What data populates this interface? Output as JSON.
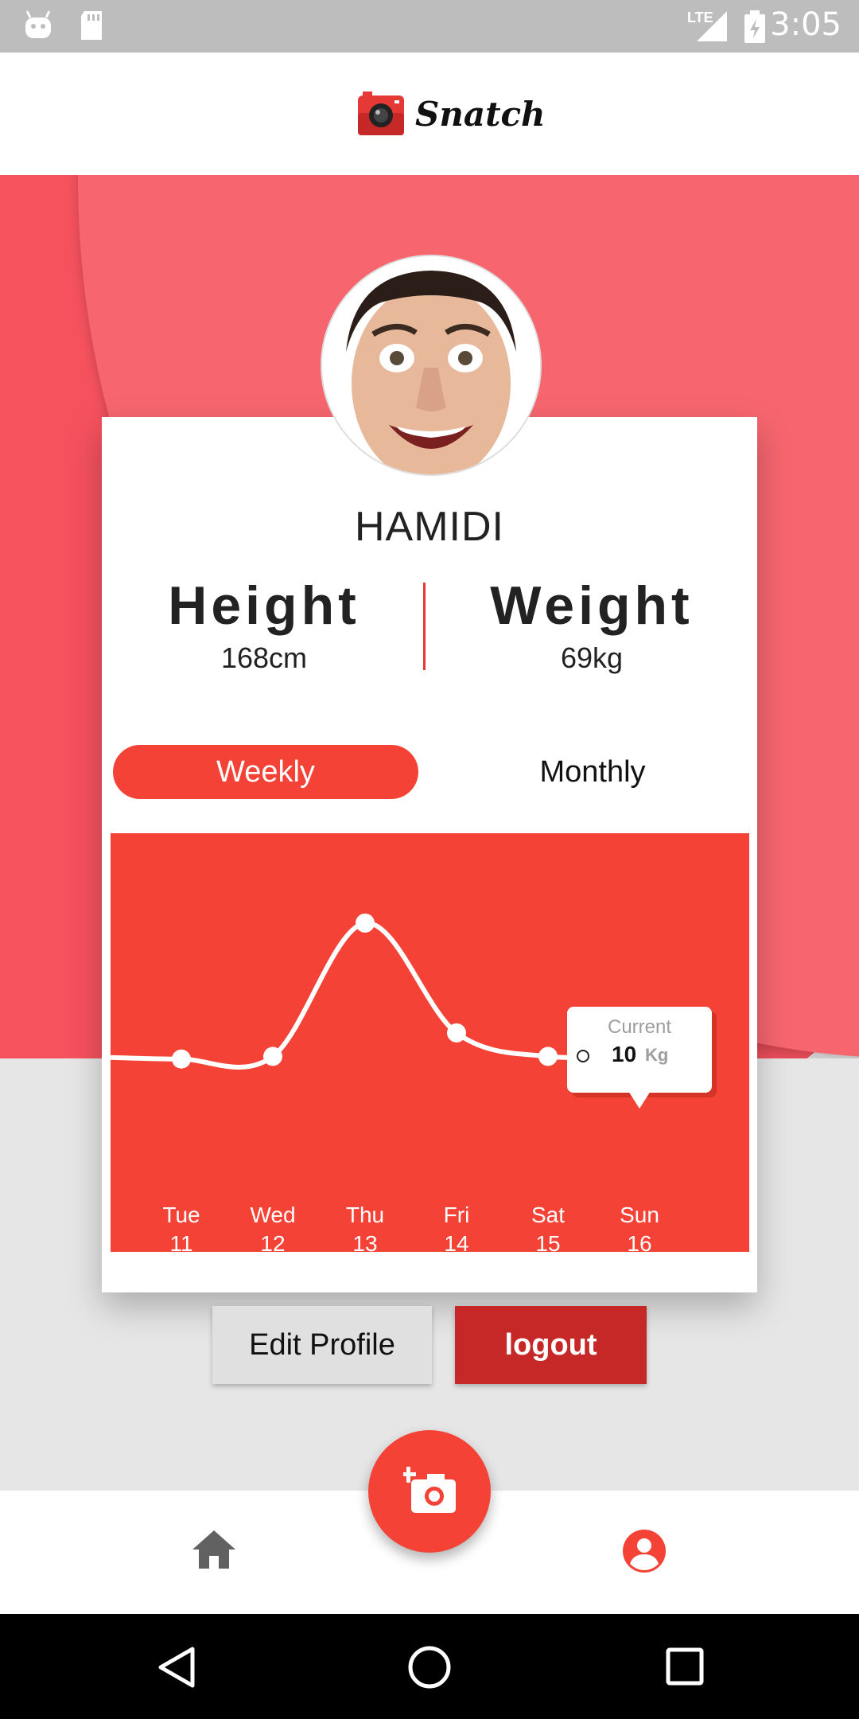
{
  "status_bar": {
    "time": "3:05",
    "network": "LTE"
  },
  "app": {
    "name": "Snatch"
  },
  "profile": {
    "name": "HAMIDI",
    "height": {
      "label": "Height",
      "value": "168cm"
    },
    "weight": {
      "label": "Weight",
      "value": "69kg"
    }
  },
  "tabs": {
    "weekly": "Weekly",
    "monthly": "Monthly",
    "selected": "Weekly"
  },
  "chart_data": {
    "type": "line",
    "categories": [
      "Tue 11",
      "Wed 12",
      "Thu 13",
      "Fri 14",
      "Sat 15",
      "Sun 16"
    ],
    "x_days": [
      "Tue",
      "Wed",
      "Thu",
      "Fri",
      "Sat",
      "Sun"
    ],
    "x_dates": [
      "11",
      "12",
      "13",
      "14",
      "15",
      "16"
    ],
    "values": [
      8,
      9,
      60,
      18,
      9,
      10
    ],
    "ylim": [
      0,
      70
    ],
    "grid": false,
    "tooltip": {
      "title": "Current",
      "value": "10",
      "unit": "Kg",
      "category": "Sun 16"
    }
  },
  "buttons": {
    "edit_profile": "Edit Profile",
    "logout": "logout"
  },
  "nav": {
    "home": "home-icon",
    "profile": "account-circle-icon",
    "fab": "add-photo-icon"
  },
  "colors": {
    "accent": "#f44336",
    "dark_red": "#c62828",
    "background": "#e6e6e6"
  }
}
